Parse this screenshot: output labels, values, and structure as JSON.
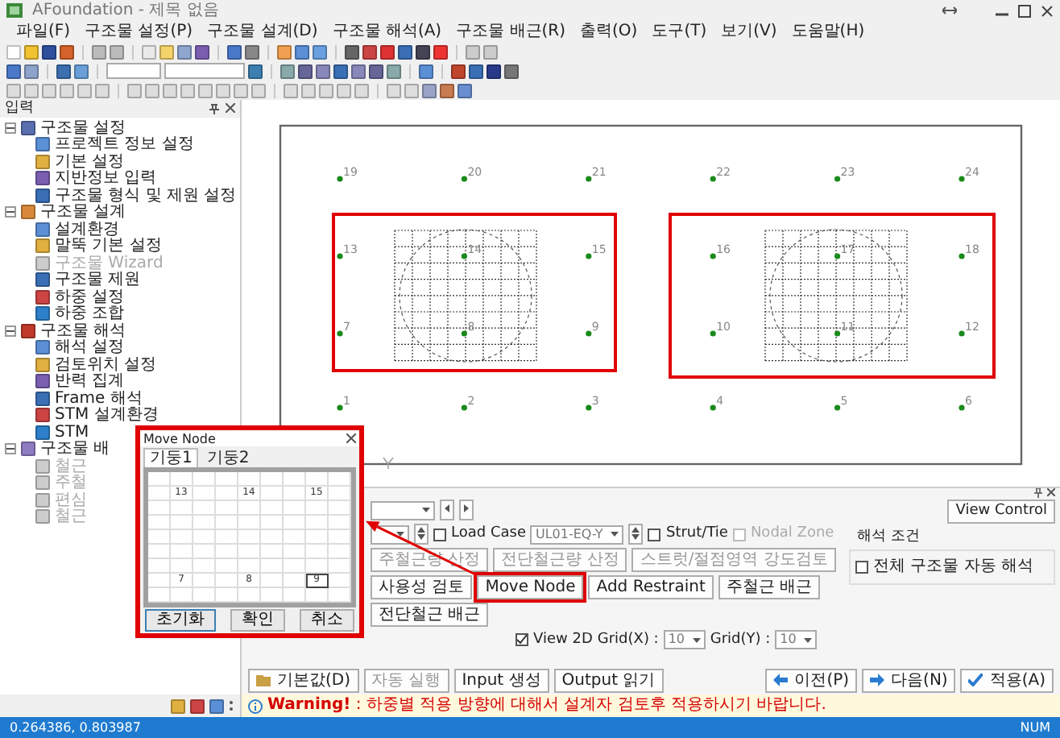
{
  "window": {
    "title": "AFoundation - 제목 없음"
  },
  "menu": [
    "파일(F)",
    "구조물 설정(P)",
    "구조물 설계(D)",
    "구조물 해석(A)",
    "구조물 배근(R)",
    "출력(O)",
    "도구(T)",
    "보기(V)",
    "도움말(H)"
  ],
  "input_panel": {
    "title": "입력",
    "tree": [
      {
        "label": "구조물 설정",
        "expanded": true,
        "children": [
          {
            "label": "프로젝트 정보 설정",
            "disabled": false
          },
          {
            "label": "기본 설정",
            "disabled": false
          },
          {
            "label": "지반정보 입력",
            "disabled": false
          },
          {
            "label": "구조물 형식 및 제원 설정",
            "disabled": false
          }
        ]
      },
      {
        "label": "구조물 설계",
        "expanded": true,
        "children": [
          {
            "label": "설계환경",
            "disabled": false
          },
          {
            "label": "말뚝 기본 설정",
            "disabled": false
          },
          {
            "label": "구조물 Wizard",
            "disabled": true
          },
          {
            "label": "구조물 제원",
            "disabled": false
          },
          {
            "label": "하중 설정",
            "disabled": false
          },
          {
            "label": "하중 조합",
            "disabled": false
          }
        ]
      },
      {
        "label": "구조물 해석",
        "expanded": true,
        "children": [
          {
            "label": "해석 설정",
            "disabled": false
          },
          {
            "label": "검토위치 설정",
            "disabled": false
          },
          {
            "label": "반력 집계",
            "disabled": false
          },
          {
            "label": "Frame 해석",
            "disabled": false
          },
          {
            "label": "STM 설계환경",
            "disabled": false
          },
          {
            "label": "STM",
            "disabled": false
          }
        ]
      },
      {
        "label": "구조물 배",
        "expanded": true,
        "children": [
          {
            "label": "철근",
            "disabled": true
          },
          {
            "label": "주철",
            "disabled": true
          },
          {
            "label": "편심",
            "disabled": true
          },
          {
            "label": "철근",
            "disabled": true
          }
        ]
      }
    ]
  },
  "canvas": {
    "node_rows": [
      [
        "19",
        "20",
        "21",
        "22",
        "23",
        "24"
      ],
      [
        "13",
        "14",
        "15",
        "16",
        "17",
        "18"
      ],
      [
        "7",
        "8",
        "9",
        "10",
        "11",
        "12"
      ],
      [
        "1",
        "2",
        "3",
        "4",
        "5",
        "6"
      ]
    ],
    "footings": [
      {
        "highlighted": true
      },
      {
        "highlighted": true
      }
    ]
  },
  "move_node_dialog": {
    "title": "Move Node",
    "highlighted": true,
    "tabs": [
      {
        "label": "기둥1",
        "selected": true
      },
      {
        "label": "기둥2",
        "selected": false
      }
    ],
    "label_rows": [
      {
        "labels": [
          {
            "text": "13",
            "selected": false
          },
          {
            "text": "14",
            "selected": false
          },
          {
            "text": "15",
            "selected": false
          }
        ]
      },
      {
        "labels": [
          {
            "text": "7",
            "selected": false
          },
          {
            "text": "8",
            "selected": false
          },
          {
            "text": "9",
            "selected": true
          }
        ]
      }
    ],
    "buttons": [
      "초기화",
      "확인",
      "취소"
    ]
  },
  "design_panel": {
    "load_case": {
      "label": "Load Case",
      "checked": false,
      "value": "UL01-EQ-Y"
    },
    "strut_tie": {
      "label": "Strut/Tie",
      "checked": false
    },
    "nodal_zone": {
      "label": "Nodal Zone",
      "checked": false,
      "disabled": true
    },
    "actions": [
      {
        "label": "주철근량 산정",
        "disabled": true,
        "highlighted": false
      },
      {
        "label": "전단철근량 산정",
        "disabled": true,
        "highlighted": false
      },
      {
        "label": "스트럿/절점영역 강도검토",
        "disabled": true,
        "highlighted": false
      },
      {
        "label": "사용성 검토",
        "disabled": false,
        "highlighted": false
      },
      {
        "label": "Move Node",
        "disabled": false,
        "highlighted": true
      },
      {
        "label": "Add Restraint",
        "disabled": false,
        "highlighted": false
      },
      {
        "label": "주철근 배근",
        "disabled": false,
        "highlighted": false
      },
      {
        "label": "전단철근 배근",
        "disabled": false,
        "highlighted": false
      }
    ],
    "view_2d": {
      "label": "View 2D",
      "checked": true
    },
    "grid_x": {
      "label": "Grid(X) :",
      "value": "10"
    },
    "grid_y": {
      "label": "Grid(Y) :",
      "value": "10"
    },
    "view_control": "View Control",
    "analysis_group": {
      "title": "해석 조건",
      "label": "전체 구조물 자동 해석",
      "checked": false
    },
    "run_buttons": [
      {
        "label": "기본값(D)",
        "disabled": false
      },
      {
        "label": "자동 실행",
        "disabled": true
      },
      {
        "label": "Input 생성",
        "disabled": false
      },
      {
        "label": "Output 읽기",
        "disabled": false
      }
    ],
    "nav_buttons": [
      "이전(P)",
      "다음(N)",
      "적용(A)"
    ]
  },
  "warning": "**Warning!** : 하중별 적용 방향에 대해서 설계자 검토후 적용하시기 바랍니다.",
  "status_bar": {
    "coordinates": "0.264386, 0.803987",
    "mode": "NUM"
  }
}
